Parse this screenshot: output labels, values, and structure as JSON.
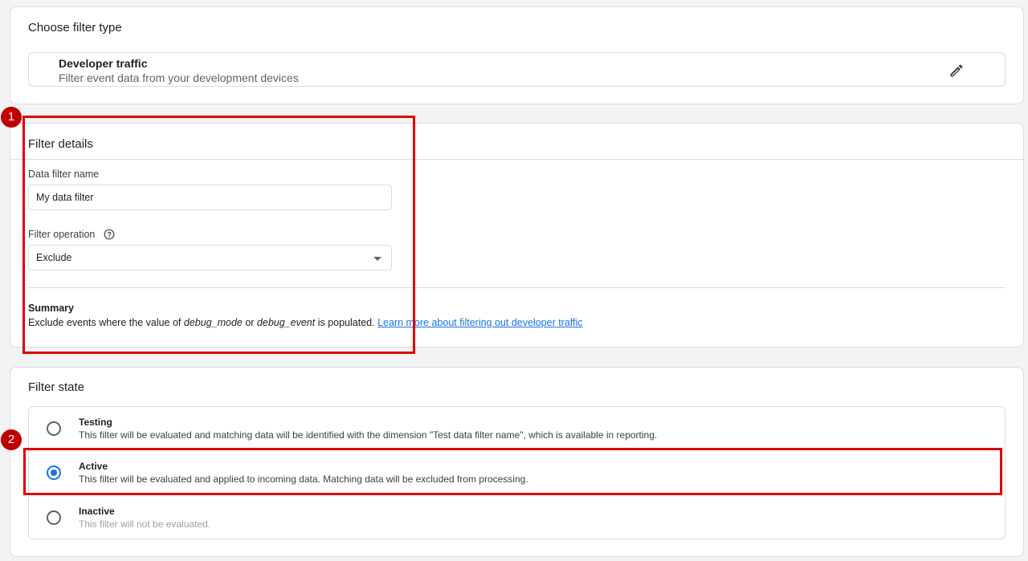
{
  "filter_type": {
    "heading": "Choose filter type",
    "name": "Developer traffic",
    "description": "Filter event data from your development devices",
    "edit_icon": "pencil-icon"
  },
  "filter_details": {
    "heading": "Filter details",
    "name_label": "Data filter name",
    "name_value": "My data filter",
    "operation_label": "Filter operation",
    "help_icon": "help-circle-icon",
    "operation_value": "Exclude",
    "summary_title": "Summary",
    "summary_pre": "Exclude events where the value of ",
    "summary_term1": "debug_mode",
    "summary_mid": " or ",
    "summary_term2": "debug_event",
    "summary_post": " is populated. ",
    "summary_link": "Learn more about filtering out developer traffic"
  },
  "filter_state": {
    "heading": "Filter state",
    "options": [
      {
        "title": "Testing",
        "description": "This filter will be evaluated and matching data will be identified with the dimension \"Test data filter name\", which is available in reporting.",
        "selected": false
      },
      {
        "title": "Active",
        "description": "This filter will be evaluated and applied to incoming data. Matching data will be excluded from processing.",
        "selected": true
      },
      {
        "title": "Inactive",
        "description": "This filter will not be evaluated.",
        "selected": false
      }
    ]
  },
  "annotations": {
    "badge_1": "1",
    "badge_2": "2",
    "highlight_color": "#e00000",
    "badge_color": "#c00000"
  },
  "colors": {
    "accent": "#1a73e8",
    "background": "#f1f3f4"
  }
}
